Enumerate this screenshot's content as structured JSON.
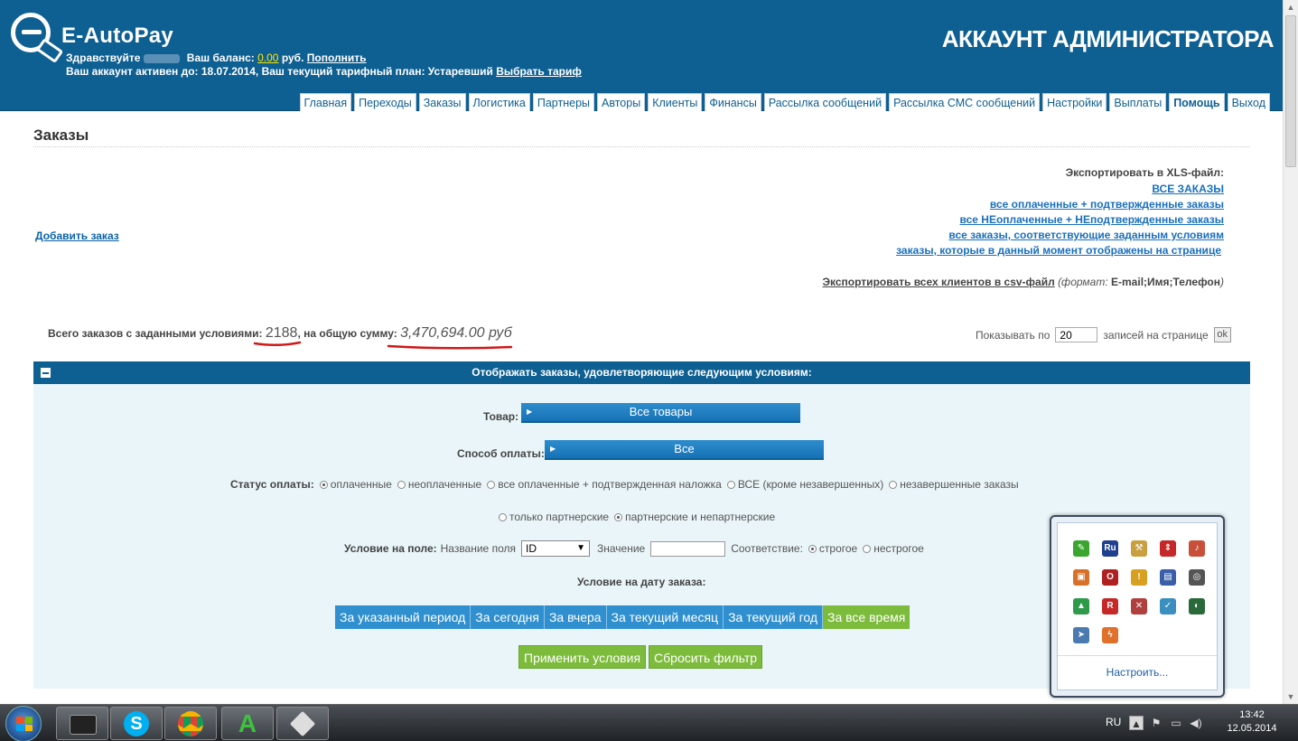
{
  "header": {
    "logo_text": "E-AutoPay",
    "greeting": "Здравствуйте",
    "balance_label": "Ваш баланс:",
    "balance_value": "0.00",
    "balance_unit": "руб.",
    "topup_link": "Пополнить",
    "account_text": "Ваш аккаунт активен до: 18.07.2014, Ваш текущий тарифный план: Устаревший",
    "choose_plan_link": "Выбрать тариф",
    "admin_title": "АККАУНТ АДМИНИСТРАТОРА",
    "nav": [
      {
        "label": "Главная"
      },
      {
        "label": "Переходы"
      },
      {
        "label": "Заказы"
      },
      {
        "label": "Логистика"
      },
      {
        "label": "Партнеры"
      },
      {
        "label": "Авторы"
      },
      {
        "label": "Клиенты"
      },
      {
        "label": "Финансы"
      },
      {
        "label": "Рассылка сообщений"
      },
      {
        "label": "Рассылка СМС сообщений"
      },
      {
        "label": "Настройки"
      },
      {
        "label": "Выплаты"
      },
      {
        "label": "Помощь"
      },
      {
        "label": "Выход"
      }
    ]
  },
  "page": {
    "title": "Заказы",
    "add_order": "Добавить заказ"
  },
  "export": {
    "label": "Экспортировать в XLS-файл:",
    "links": [
      "ВСЕ ЗАКАЗЫ",
      "все оплаченные + подтвержденные заказы",
      "все НЕоплаченные + НЕподтвержденные заказы",
      "все заказы, соответствующие заданным условиям",
      "заказы, которые в данный момент отображены на странице"
    ],
    "csv_link": "Экспортировать всех клиентов в csv-файл",
    "csv_format_label": "(формат:",
    "csv_format_value": "E-mail;Имя;Телефон",
    "csv_format_close": ")"
  },
  "totals": {
    "label": "Всего заказов с заданными условиями:",
    "count": "2188",
    "sum_label": ", на общую сумму:",
    "sum_value": "3,470,694.00 руб"
  },
  "pagination": {
    "show_by": "Показывать по",
    "per_page_value": "20",
    "per_page_suffix": "записей на странице",
    "ok": "ok"
  },
  "filter": {
    "title": "Отображать заказы, удовлетворяющие следующим условиям:",
    "product_label": "Товар:",
    "product_value": "Все товары",
    "payment_label": "Способ оплаты:",
    "payment_value": "Все",
    "status_label": "Статус оплаты:",
    "status_options": [
      {
        "label": "оплаченные",
        "checked": true
      },
      {
        "label": "неоплаченные",
        "checked": false
      },
      {
        "label": "все оплаченные + подтвержденная наложка",
        "checked": false
      },
      {
        "label": "ВСЕ (кроме незавершенных)",
        "checked": false
      },
      {
        "label": "незавершенные заказы",
        "checked": false
      }
    ],
    "partner_options": [
      {
        "label": "только партнерские",
        "checked": false
      },
      {
        "label": "партнерские и непартнерские",
        "checked": true
      }
    ],
    "field_cond_label": "Условие на поле:",
    "field_name_label": "Название поля",
    "field_name_value": "ID",
    "value_label": "Значение",
    "value_value": "",
    "match_label": "Соответствие:",
    "match_options": [
      {
        "label": "строгое",
        "checked": true
      },
      {
        "label": "нестрогое",
        "checked": false
      }
    ],
    "date_cond_label": "Условие на дату заказа:",
    "period_buttons": [
      {
        "label": "За указанный период",
        "active": false
      },
      {
        "label": "За сегодня",
        "active": false
      },
      {
        "label": "За вчера",
        "active": false
      },
      {
        "label": "За текущий месяц",
        "active": false
      },
      {
        "label": "За текущий год",
        "active": false
      },
      {
        "label": "За все время",
        "active": true
      }
    ],
    "apply_button": "Применить условия",
    "reset_button": "Сбросить фильтр"
  },
  "tray_popup": {
    "customize_link": "Настроить...",
    "icons": [
      {
        "name": "evernote-icon",
        "color": "#3aa62f",
        "glyph": "✎"
      },
      {
        "name": "punto-ru-icon",
        "color": "#1f3f8f",
        "glyph": "Ru"
      },
      {
        "name": "tool-icon",
        "color": "#c8a040",
        "glyph": "⚒"
      },
      {
        "name": "upload-arrow-icon",
        "color": "#c62828",
        "glyph": "⇕"
      },
      {
        "name": "speaker-icon",
        "color": "#c8503a",
        "glyph": "♪"
      },
      {
        "name": "media-icon",
        "color": "#d8702a",
        "glyph": "▣"
      },
      {
        "name": "opera-icon",
        "color": "#b02020",
        "glyph": "O"
      },
      {
        "name": "warning-icon",
        "color": "#d8a020",
        "glyph": "!"
      },
      {
        "name": "monitor-icon",
        "color": "#3a5fa8",
        "glyph": "▤"
      },
      {
        "name": "steering-icon",
        "color": "#555555",
        "glyph": "◎"
      },
      {
        "name": "google-drive-icon",
        "color": "#2f9a4a",
        "glyph": "▲"
      },
      {
        "name": "r-app-icon",
        "color": "#c62828",
        "glyph": "R"
      },
      {
        "name": "network-icon",
        "color": "#b04040",
        "glyph": "✕"
      },
      {
        "name": "pen-app-icon",
        "color": "#3a8fc0",
        "glyph": "✓"
      },
      {
        "name": "globe-icon",
        "color": "#2a6a3a",
        "glyph": "◐"
      },
      {
        "name": "pin-icon",
        "color": "#4a7ab0",
        "glyph": "➤"
      },
      {
        "name": "lightning-app-icon",
        "color": "#e0702a",
        "glyph": "ϟ"
      }
    ]
  },
  "taskbar": {
    "lang": "RU",
    "time": "13:42",
    "date": "12.05.2014"
  }
}
